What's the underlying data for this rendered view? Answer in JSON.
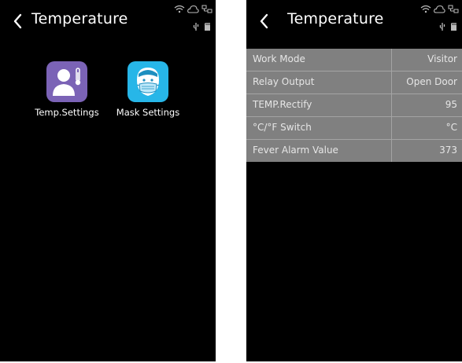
{
  "left_screen": {
    "title": "Temperature",
    "apps": [
      {
        "label": "Temp.Settings",
        "icon": "person-thermometer-icon",
        "color": "#7b63b6"
      },
      {
        "label": "Mask Settings",
        "icon": "masked-face-icon",
        "color": "#27b6e8"
      }
    ]
  },
  "right_screen": {
    "title": "Temperature",
    "settings": [
      {
        "label": "Work Mode",
        "value": "Visitor"
      },
      {
        "label": "Relay Output",
        "value": "Open Door"
      },
      {
        "label": "TEMP.Rectify",
        "value": "95"
      },
      {
        "label": "°C/°F Switch",
        "value": "°C"
      },
      {
        "label": "Fever Alarm Value",
        "value": "373"
      }
    ]
  },
  "colors": {
    "screen_bg": "#000000",
    "list_bg": "#808080",
    "list_divider": "#a4a4a4",
    "text": "#ffffff"
  }
}
